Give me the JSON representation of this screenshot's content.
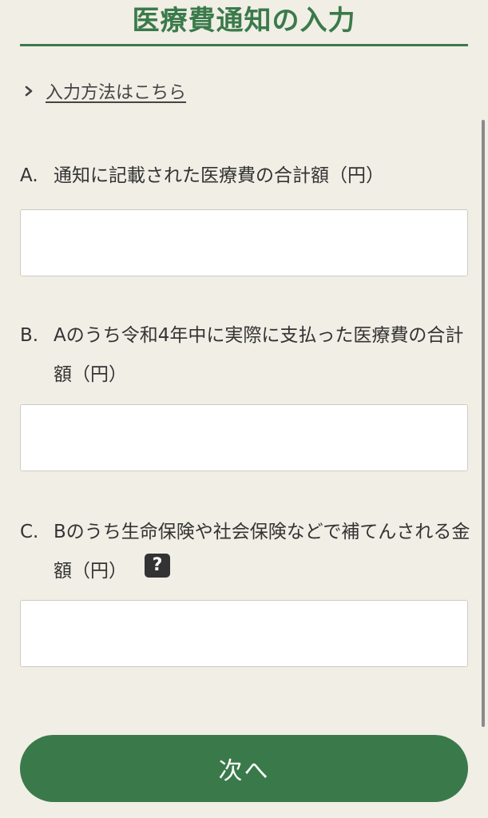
{
  "header": {
    "title": "医療費通知の入力"
  },
  "help_link": {
    "icon": "chevron-right-icon",
    "label": "入力方法はこちら"
  },
  "fields": [
    {
      "letter": "A.",
      "label": "通知に記載された医療費の合計額（円）",
      "value": ""
    },
    {
      "letter": "B.",
      "label": "Aのうち令和4年中に実際に支払った医療費の合計額（円）",
      "value": ""
    },
    {
      "letter": "C.",
      "label": "Bのうち生命保険や社会保険などで補てんされる金額（円）",
      "help_icon": "question-icon",
      "help_icon_glyph": "?",
      "value": ""
    }
  ],
  "footer": {
    "next_label": "次へ"
  },
  "colors": {
    "background": "#f1eee6",
    "accent": "#3a7a4a",
    "text": "#333333"
  }
}
